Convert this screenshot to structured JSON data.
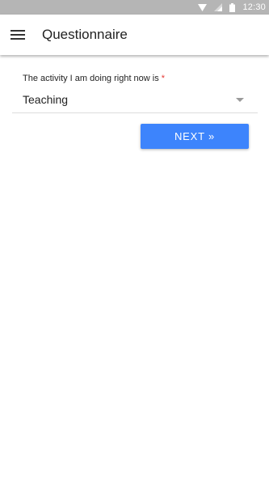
{
  "status_bar": {
    "time": "12:30",
    "icons": [
      "wifi-icon",
      "cell-signal-icon",
      "battery-icon"
    ]
  },
  "app_bar": {
    "menu_icon": "hamburger-menu-icon",
    "title": "Questionnaire"
  },
  "question": {
    "label": "The activity I am doing right now is",
    "required_marker": "*",
    "selected_value": "Teaching"
  },
  "actions": {
    "next_label": "NEXT »"
  },
  "colors": {
    "status_bar": "#b5b5b5",
    "primary_button": "#3d84fc",
    "required": "#e53935"
  }
}
